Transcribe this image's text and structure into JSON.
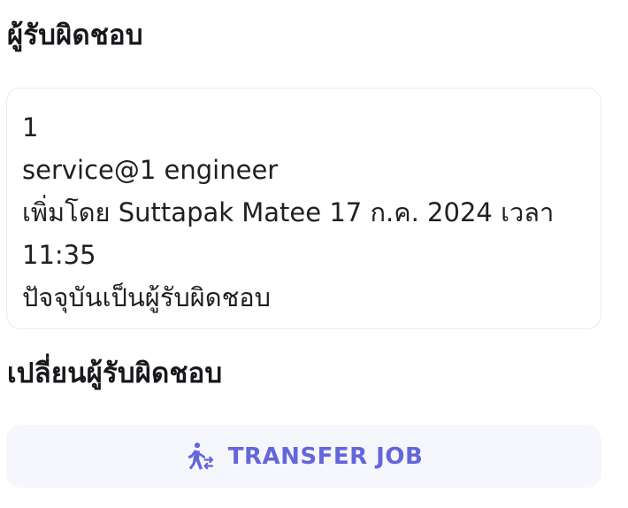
{
  "responsible_section": {
    "title": "ผู้รับผิดชอบ",
    "card": {
      "id": "1",
      "name": "service@1 engineer",
      "added_by": "เพิ่มโดย Suttapak Matee 17 ก.ค. 2024 เวลา 11:35",
      "status": "ปัจจุบันเป็นผู้รับผิดชอบ"
    }
  },
  "change_section": {
    "title": "เปลี่ยนผู้รับผิดชอบ",
    "button_label": "TRANSFER JOB",
    "button_icon": "person-transfer-icon"
  },
  "colors": {
    "accent": "#6367d8",
    "button_bg": "#f6f6fd",
    "card_border": "#ececf0",
    "text": "#1b1b1f"
  }
}
